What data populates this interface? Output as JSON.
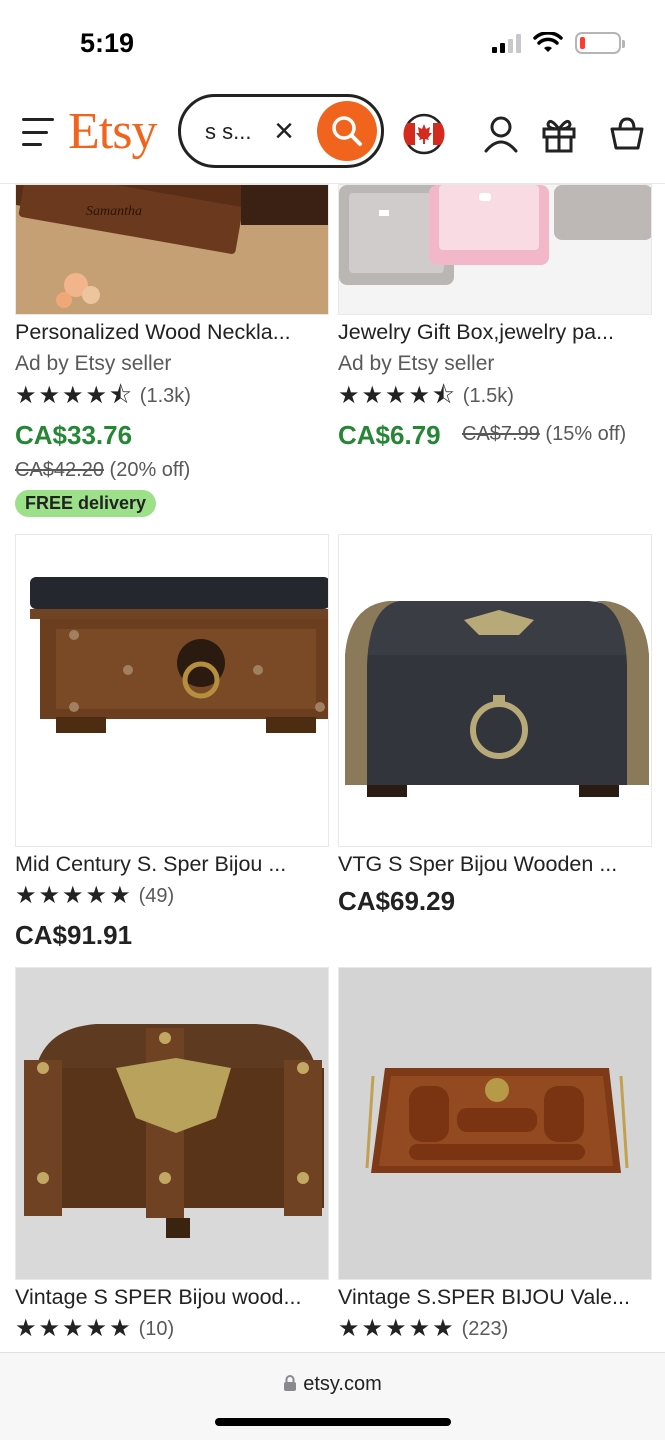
{
  "status": {
    "time": "5:19"
  },
  "header": {
    "logo": "Etsy",
    "search_value": "s s...",
    "accent": "#f1641e"
  },
  "products": [
    {
      "title": "Personalized Wood Neckla...",
      "ad": "Ad by Etsy seller",
      "rating_count": "(1.3k)",
      "stars": 4.5,
      "price": "CA$33.76",
      "original_price": "CA$42.20",
      "discount": "(20% off)",
      "badge": "FREE delivery"
    },
    {
      "title": "Jewelry Gift Box,jewelry pa...",
      "ad": "Ad by Etsy seller",
      "rating_count": "(1.5k)",
      "stars": 4.5,
      "price": "CA$6.79",
      "original_price": "CA$7.99",
      "discount": "(15% off)"
    },
    {
      "title": "Mid Century S. Sper Bijou ...",
      "rating_count": "(49)",
      "stars": 5,
      "price": "CA$91.91"
    },
    {
      "title": "VTG S Sper Bijou Wooden ...",
      "price": "CA$69.29"
    },
    {
      "title": "Vintage S SPER Bijou wood...",
      "rating_count": "(10)",
      "stars": 5
    },
    {
      "title": "Vintage S.SPER BIJOU Vale...",
      "rating_count": "(223)",
      "stars": 5
    }
  ],
  "colors": {
    "sale_price": "#258635",
    "free_badge": "#9ce18a"
  },
  "browser": {
    "url": "etsy.com"
  }
}
